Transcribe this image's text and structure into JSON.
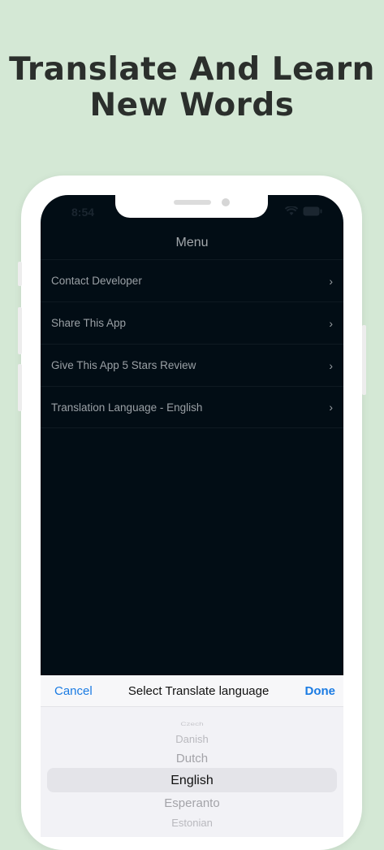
{
  "headline": {
    "line1": "Translate And Learn",
    "line2": "New Words"
  },
  "status_bar": {
    "time": "8:54"
  },
  "menu": {
    "title": "Menu",
    "items": [
      {
        "label": "Contact Developer",
        "chevron": "›"
      },
      {
        "label": "Share This App",
        "chevron": "›"
      },
      {
        "label": "Give This App 5 Stars Review",
        "chevron": "›"
      },
      {
        "label": "Translation Language - English",
        "chevron": "›"
      }
    ]
  },
  "picker_sheet": {
    "cancel_label": "Cancel",
    "title": "Select Translate language",
    "done_label": "Done",
    "options": [
      "Czech",
      "Danish",
      "Dutch",
      "English",
      "Esperanto",
      "Estonian"
    ],
    "selected": "English"
  },
  "colors": {
    "background": "#d4e8d5",
    "screen": "#020d15",
    "accent": "#1a7be3"
  },
  "icons": [
    "chevron-right-icon",
    "wifi-icon",
    "battery-icon"
  ]
}
